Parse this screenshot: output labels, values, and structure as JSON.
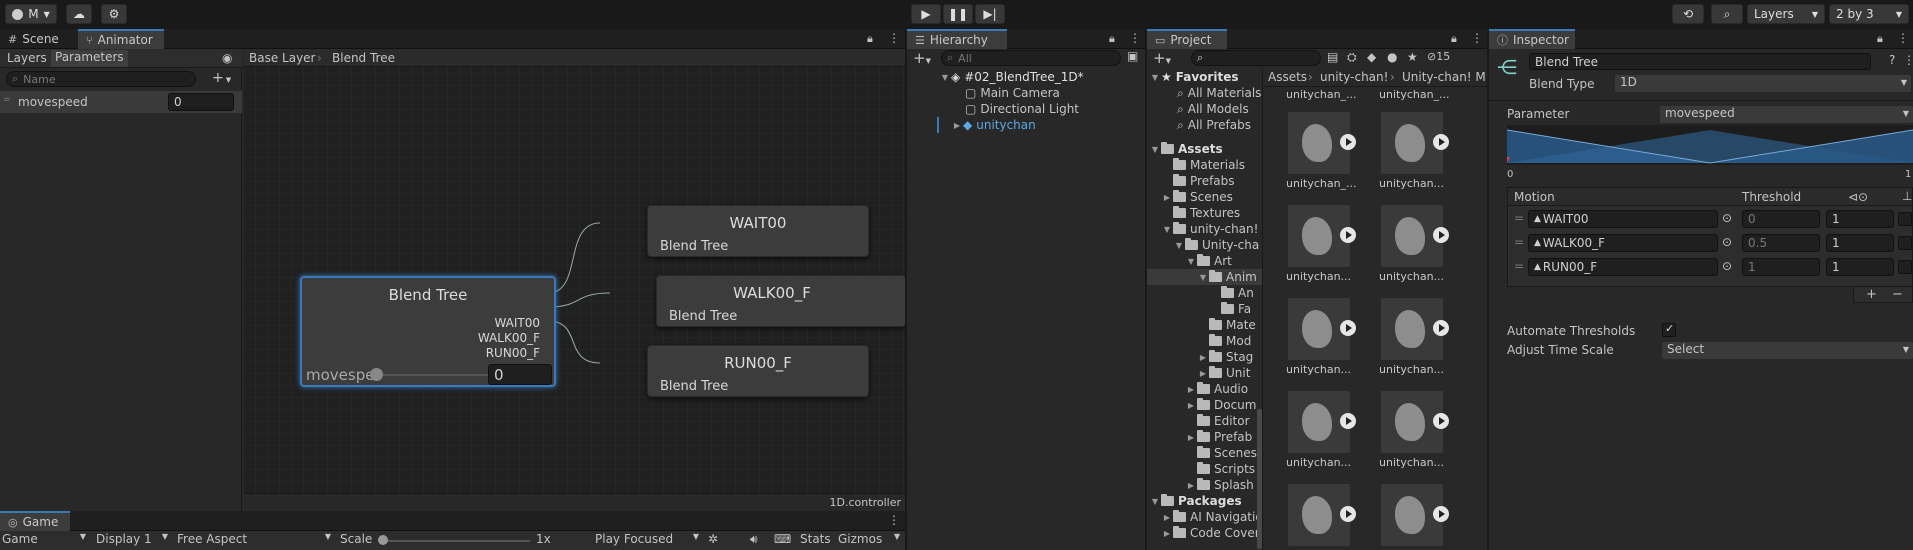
{
  "toolbar": {
    "account_label": "M",
    "layers_label": "Layers",
    "layout_label": "2 by 3"
  },
  "animator": {
    "tabs": {
      "scene": "Scene",
      "animator": "Animator"
    },
    "sub_tabs": {
      "layers": "Layers",
      "parameters": "Parameters"
    },
    "search_placeholder": "Name",
    "parameter": {
      "name": "movespeed",
      "value": "0"
    },
    "breadcrumb": {
      "base": "Base Layer",
      "tree": "Blend Tree"
    },
    "blend_node": {
      "title": "Blend Tree",
      "outputs": [
        "WAIT00",
        "WALK00_F",
        "RUN00_F"
      ],
      "param_label": "movespe",
      "param_value": "0"
    },
    "motion_nodes": [
      {
        "title": "WAIT00",
        "sub": "Blend Tree"
      },
      {
        "title": "WALK00_F",
        "sub": "Blend Tree"
      },
      {
        "title": "RUN00_F",
        "sub": "Blend Tree"
      }
    ],
    "footer_file": "1D.controller"
  },
  "game": {
    "tab": "Game",
    "display_mode": "Game",
    "display": "Display 1",
    "aspect": "Free Aspect",
    "scale_label": "Scale",
    "scale_value": "1x",
    "play_mode": "Play Focused",
    "stats": "Stats",
    "gizmos": "Gizmos"
  },
  "hierarchy": {
    "tab": "Hierarchy",
    "search_placeholder": "All",
    "scene": "#02_BlendTree_1D*",
    "items": [
      "Main Camera",
      "Directional Light",
      "unitychan"
    ]
  },
  "project": {
    "tab": "Project",
    "hidden_count": "15",
    "breadcrumb": [
      "Assets",
      "unity-chan!",
      "Unity-chan! M"
    ],
    "favorites": {
      "title": "Favorites",
      "items": [
        "All Materials",
        "All Models",
        "All Prefabs"
      ]
    },
    "assets_tree": [
      {
        "label": "Assets",
        "depth": 0
      },
      {
        "label": "Materials",
        "depth": 1
      },
      {
        "label": "Prefabs",
        "depth": 1
      },
      {
        "label": "Scenes",
        "depth": 1
      },
      {
        "label": "Textures",
        "depth": 1
      },
      {
        "label": "unity-chan!",
        "depth": 1
      },
      {
        "label": "Unity-cha",
        "depth": 2
      },
      {
        "label": "Art",
        "depth": 3
      },
      {
        "label": "Anim",
        "depth": 4
      },
      {
        "label": "An",
        "depth": 5
      },
      {
        "label": "Fa",
        "depth": 5
      },
      {
        "label": "Mate",
        "depth": 4
      },
      {
        "label": "Mod",
        "depth": 4
      },
      {
        "label": "Stag",
        "depth": 4
      },
      {
        "label": "Unit",
        "depth": 4
      },
      {
        "label": "Audio",
        "depth": 3
      },
      {
        "label": "Docum",
        "depth": 3
      },
      {
        "label": "Editor",
        "depth": 3
      },
      {
        "label": "Prefab",
        "depth": 3
      },
      {
        "label": "Scenes",
        "depth": 3
      },
      {
        "label": "Scripts",
        "depth": 3
      },
      {
        "label": "Splash",
        "depth": 3
      }
    ],
    "packages": {
      "title": "Packages",
      "items": [
        "AI Navigatio",
        "Code Cover"
      ]
    },
    "top_labels": [
      "unitychan_...",
      "unitychan_..."
    ],
    "asset_labels": [
      "unitychan_...",
      "unitychan...",
      "unitychan...",
      "unitychan...",
      "unitychan...",
      "unitychan...",
      "unitychan...",
      "unitychan...",
      "",
      ""
    ]
  },
  "inspector": {
    "tab": "Inspector",
    "object_name": "Blend Tree",
    "blend_type_label": "Blend Type",
    "blend_type_value": "1D",
    "parameter_label": "Parameter",
    "parameter_value": "movespeed",
    "range_min": "0",
    "range_max": "1",
    "motion_header": "Motion",
    "threshold_header": "Threshold",
    "motions": [
      {
        "name": "WAIT00",
        "threshold": "0",
        "speed": "1"
      },
      {
        "name": "WALK00_F",
        "threshold": "0.5",
        "speed": "1"
      },
      {
        "name": "RUN00_F",
        "threshold": "1",
        "speed": "1"
      }
    ],
    "add_label": "+",
    "remove_label": "−",
    "automate_label": "Automate Thresholds",
    "adjust_label": "Adjust Time Scale",
    "adjust_value": "Select"
  },
  "colors": {
    "accent": "#3a79bb",
    "selected": "#2c5d87",
    "link": "#5aa9e6"
  }
}
